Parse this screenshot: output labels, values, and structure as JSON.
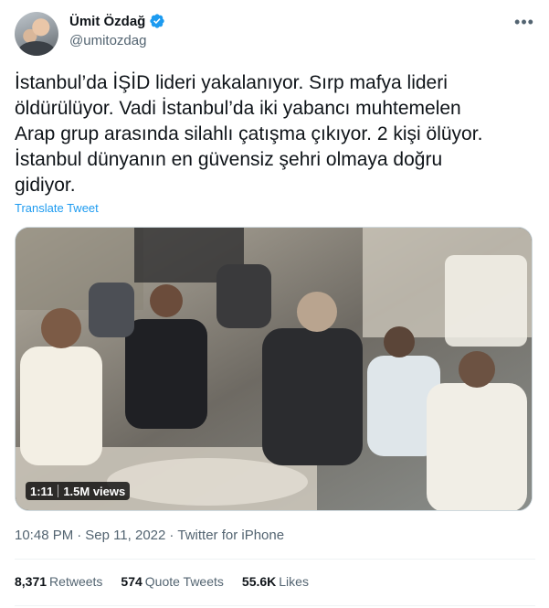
{
  "author": {
    "name": "Ümit Özdağ",
    "handle": "@umitozdag",
    "verified": true
  },
  "tweet": {
    "text": "İstanbul’da İŞİD lideri yakalanıyor. Sırp mafya lideri\nöldürülüyor. Vadi İstanbul’da iki yabancı muhtemelen\nArap grup arasında silahlı çatışma çıkıyor. 2 kişi ölüyor.\nİstanbul dünyanın en güvensiz şehri olmaya doğru\ngidiyor.",
    "translate_label": "Translate Tweet"
  },
  "video": {
    "duration": "1:11",
    "views": "1.5M views"
  },
  "meta": {
    "time": "10:48 PM",
    "separator": "·",
    "date": "Sep 11, 2022",
    "source": "Twitter for iPhone"
  },
  "stats": {
    "retweets_count": "8,371",
    "retweets_label": "Retweets",
    "quotes_count": "574",
    "quotes_label": "Quote Tweets",
    "likes_count": "55.6K",
    "likes_label": "Likes"
  },
  "icons": {
    "verified": "verified-badge-icon",
    "more": "more-options-icon"
  },
  "colors": {
    "accent": "#1d9bf0",
    "secondary_text": "#536471",
    "primary_text": "#0f1419"
  }
}
